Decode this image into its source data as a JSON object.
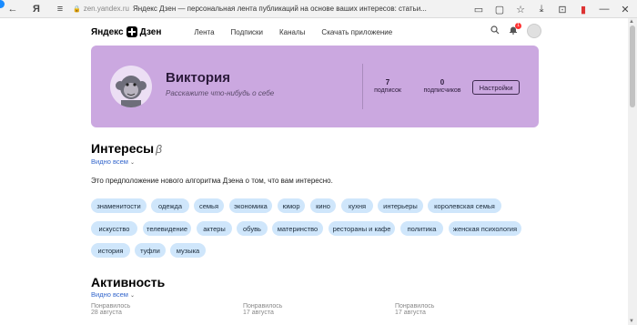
{
  "browser": {
    "url_domain": "zen.yandex.ru",
    "url_title": "Яндекс Дзен — персональная лента публикаций на основе ваших интересов: статьи...",
    "back_icon": "←",
    "yandex_icon": "Я",
    "star_icon": "☆",
    "menu_icon": "≡",
    "tab_icon": "▭",
    "collections_icon": "▢",
    "download_icon": "⤓",
    "pocket_icon": "⊡",
    "minimize_icon": "—",
    "close_icon": "✕"
  },
  "site": {
    "logo_left": "Яндекс",
    "logo_right": "Дзен",
    "nav": [
      "Лента",
      "Подписки",
      "Каналы",
      "Скачать приложение"
    ],
    "notifications_count": "1"
  },
  "profile": {
    "name": "Виктория",
    "subtitle": "Расскажите что-нибудь о себе",
    "subscriptions_count": "7",
    "subscriptions_label": "подписок",
    "subscribers_count": "0",
    "subscribers_label": "подписчиков",
    "settings_label": "Настройки"
  },
  "interests": {
    "title": "Интересы",
    "beta": "β",
    "visible_label": "Видно всем",
    "hint": "Это предположение нового алгоритма Дзена о том, что вам интересно.",
    "tags": [
      "знаменитости",
      "одежда",
      "семья",
      "экономика",
      "юмор",
      "кино",
      "кухня",
      "интерьеры",
      "королевская семья",
      "искусство",
      "телевидение",
      "актеры",
      "обувь",
      "материнство",
      "рестораны и кафе",
      "политика",
      "женская психология",
      "история",
      "туфли",
      "музыка"
    ]
  },
  "activity": {
    "title": "Активность",
    "visible_label": "Видно всем",
    "items": [
      {
        "label": "Понравилось",
        "date": "28 августа"
      },
      {
        "label": "Понравилось",
        "date": "17 августа"
      },
      {
        "label": "Понравилось",
        "date": "17 августа"
      }
    ]
  },
  "colors": {
    "profile_bg": "#cba8e0",
    "tag_bg": "#cfe6fb",
    "link": "#3366cc"
  }
}
